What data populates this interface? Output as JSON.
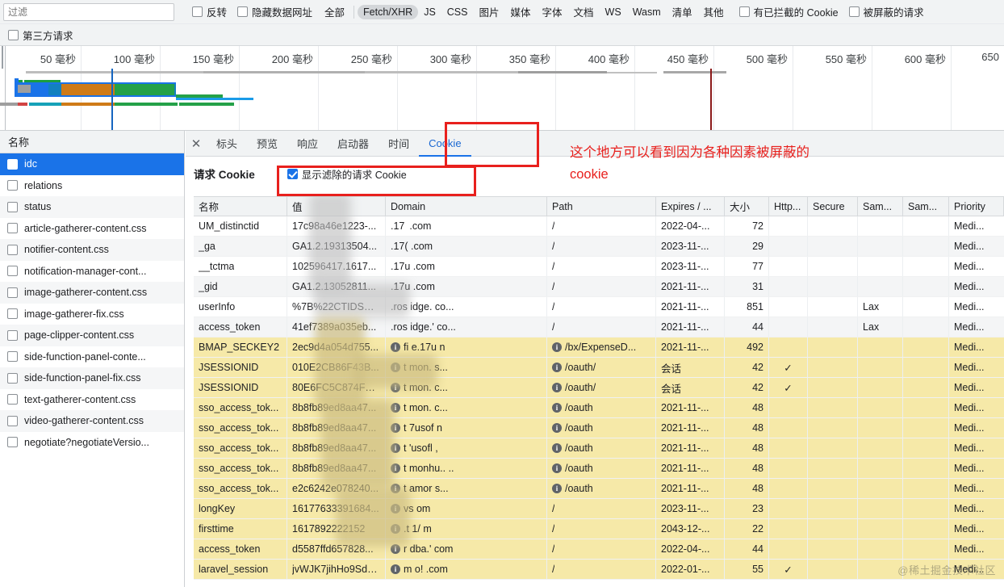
{
  "toolbar": {
    "filter_placeholder": "过滤",
    "invert_label": "反转",
    "hide_data_urls_label": "隐藏数据网址",
    "types": [
      {
        "label": "全部",
        "active": false
      },
      {
        "label": "Fetch/XHR",
        "active": true
      },
      {
        "label": "JS",
        "active": false
      },
      {
        "label": "CSS",
        "active": false
      },
      {
        "label": "图片",
        "active": false
      },
      {
        "label": "媒体",
        "active": false
      },
      {
        "label": "字体",
        "active": false
      },
      {
        "label": "文档",
        "active": false
      },
      {
        "label": "WS",
        "active": false
      },
      {
        "label": "Wasm",
        "active": false
      },
      {
        "label": "清单",
        "active": false
      },
      {
        "label": "其他",
        "active": false
      }
    ],
    "blocked_cookies_label": "有已拦截的 Cookie",
    "blocked_requests_label": "被屏蔽的请求",
    "third_party_label": "第三方请求"
  },
  "overview": {
    "ticks": [
      "50 毫秒",
      "100 毫秒",
      "150 毫秒",
      "200 毫秒",
      "250 毫秒",
      "300 毫秒",
      "350 毫秒",
      "400 毫秒",
      "450 毫秒",
      "500 毫秒",
      "550 毫秒",
      "600 毫秒",
      "650"
    ],
    "dom_content_loaded_color": "#1565c0",
    "load_event_color": "#8b1a1a"
  },
  "sidebar": {
    "header": "名称",
    "items": [
      {
        "name": "idc",
        "selected": true
      },
      {
        "name": "relations",
        "selected": false
      },
      {
        "name": "status",
        "selected": false
      },
      {
        "name": "article-gatherer-content.css",
        "selected": false
      },
      {
        "name": "notifier-content.css",
        "selected": false
      },
      {
        "name": "notification-manager-cont...",
        "selected": false
      },
      {
        "name": "image-gatherer-content.css",
        "selected": false
      },
      {
        "name": "image-gatherer-fix.css",
        "selected": false
      },
      {
        "name": "page-clipper-content.css",
        "selected": false
      },
      {
        "name": "side-function-panel-conte...",
        "selected": false
      },
      {
        "name": "side-function-panel-fix.css",
        "selected": false
      },
      {
        "name": "text-gatherer-content.css",
        "selected": false
      },
      {
        "name": "video-gatherer-content.css",
        "selected": false
      },
      {
        "name": "negotiate?negotiateVersio...",
        "selected": false
      }
    ]
  },
  "detail": {
    "close_label": "✕",
    "tabs": [
      {
        "label": "标头",
        "active": false
      },
      {
        "label": "预览",
        "active": false
      },
      {
        "label": "响应",
        "active": false
      },
      {
        "label": "启动器",
        "active": false
      },
      {
        "label": "时间",
        "active": false
      },
      {
        "label": "Cookie",
        "active": true
      }
    ],
    "section_title": "请求 Cookie",
    "show_filtered_label": "显示滤除的请求 Cookie",
    "show_filtered_checked": true
  },
  "annotation": {
    "text": "这个地方可以看到因为各种因素被屏蔽的\ncookie",
    "color": "#e8201d"
  },
  "cookie_table": {
    "columns": [
      "名称",
      "值",
      "Domain",
      "Path",
      "Expires / ...",
      "大小",
      "Http...",
      "Secure",
      "Sam...",
      "Sam...",
      "Priority"
    ],
    "rows": [
      {
        "name": "UM_distinctid",
        "value": "17c98a46e1223-...",
        "domain": ".17    .com",
        "domain_info": false,
        "path": "/",
        "path_info": false,
        "expires": "2022-04-...",
        "size": "72",
        "http": "",
        "secure": "",
        "samesite": "",
        "sameparty": "",
        "priority": "Medi...",
        "blocked": false,
        "shade": "white"
      },
      {
        "name": "_ga",
        "value": "GA1.2.19313504...",
        "domain": ".17(   .com",
        "domain_info": false,
        "path": "/",
        "path_info": false,
        "expires": "2023-11-...",
        "size": "29",
        "http": "",
        "secure": "",
        "samesite": "",
        "sameparty": "",
        "priority": "Medi...",
        "blocked": false,
        "shade": "grey"
      },
      {
        "name": "__tctma",
        "value": "102596417.1617...",
        "domain": ".17u   .com",
        "domain_info": false,
        "path": "/",
        "path_info": false,
        "expires": "2023-11-...",
        "size": "77",
        "http": "",
        "secure": "",
        "samesite": "",
        "sameparty": "",
        "priority": "Medi...",
        "blocked": false,
        "shade": "white"
      },
      {
        "name": "_gid",
        "value": "GA1.2.13052811...",
        "domain": ".17u   .com",
        "domain_info": false,
        "path": "/",
        "path_info": false,
        "expires": "2021-11-...",
        "size": "31",
        "http": "",
        "secure": "",
        "samesite": "",
        "sameparty": "",
        "priority": "Medi...",
        "blocked": false,
        "shade": "grey"
      },
      {
        "name": "userInfo",
        "value": "%7B%22CTIDS%...",
        "domain": ".ros   idge.      co...",
        "domain_info": false,
        "path": "/",
        "path_info": false,
        "expires": "2021-11-...",
        "size": "851",
        "http": "",
        "secure": "",
        "samesite": "Lax",
        "sameparty": "",
        "priority": "Medi...",
        "blocked": false,
        "shade": "white"
      },
      {
        "name": "access_token",
        "value": "41ef7389a035eb...",
        "domain": ".ros   idge.'     co...",
        "domain_info": false,
        "path": "/",
        "path_info": false,
        "expires": "2021-11-...",
        "size": "44",
        "http": "",
        "secure": "",
        "samesite": "Lax",
        "sameparty": "",
        "priority": "Medi...",
        "blocked": false,
        "shade": "grey"
      },
      {
        "name": "BMAP_SECKEY2",
        "value": "2ec9d4a054d755...",
        "domain": "fi   e.17u      n",
        "domain_info": true,
        "path": "/bx/ExpenseD...",
        "path_info": true,
        "expires": "2021-11-...",
        "size": "492",
        "http": "",
        "secure": "",
        "samesite": "",
        "sameparty": "",
        "priority": "Medi...",
        "blocked": true,
        "shade": "yellow"
      },
      {
        "name": "JSESSIONID",
        "value": "010E2CB86F43B...",
        "domain": "t   mon.      s...",
        "domain_info": true,
        "path": "/oauth/",
        "path_info": true,
        "expires": "会话",
        "size": "42",
        "http": "✓",
        "secure": "",
        "samesite": "",
        "sameparty": "",
        "priority": "Medi...",
        "blocked": true,
        "shade": "yellow"
      },
      {
        "name": "JSESSIONID",
        "value": "80E6FC5C874F6E...",
        "domain": "t   mon.      c...",
        "domain_info": true,
        "path": "/oauth/",
        "path_info": true,
        "expires": "会话",
        "size": "42",
        "http": "✓",
        "secure": "",
        "samesite": "",
        "sameparty": "",
        "priority": "Medi...",
        "blocked": true,
        "shade": "yellow"
      },
      {
        "name": "sso_access_tok...",
        "value": "8b8fb89ed8aa47...",
        "domain": "t   mon.      c...",
        "domain_info": true,
        "path": "/oauth",
        "path_info": true,
        "expires": "2021-11-...",
        "size": "48",
        "http": "",
        "secure": "",
        "samesite": "",
        "sameparty": "",
        "priority": "Medi...",
        "blocked": true,
        "shade": "yellow"
      },
      {
        "name": "sso_access_tok...",
        "value": "8b8fb89ed8aa47...",
        "domain": "t   7usof    n",
        "domain_info": true,
        "path": "/oauth",
        "path_info": true,
        "expires": "2021-11-...",
        "size": "48",
        "http": "",
        "secure": "",
        "samesite": "",
        "sameparty": "",
        "priority": "Medi...",
        "blocked": true,
        "shade": "yellow"
      },
      {
        "name": "sso_access_tok...",
        "value": "8b8fb89ed8aa47...",
        "domain": "t   'usofl    ,",
        "domain_info": true,
        "path": "/oauth",
        "path_info": true,
        "expires": "2021-11-...",
        "size": "48",
        "http": "",
        "secure": "",
        "samesite": "",
        "sameparty": "",
        "priority": "Medi...",
        "blocked": true,
        "shade": "yellow"
      },
      {
        "name": "sso_access_tok...",
        "value": "8b8fb89ed8aa47...",
        "domain": "t   monhu..    ..",
        "domain_info": true,
        "path": "/oauth",
        "path_info": true,
        "expires": "2021-11-...",
        "size": "48",
        "http": "",
        "secure": "",
        "samesite": "",
        "sameparty": "",
        "priority": "Medi...",
        "blocked": true,
        "shade": "yellow"
      },
      {
        "name": "sso_access_tok...",
        "value": "e2c6242e078240...",
        "domain": "t   amor      s...",
        "domain_info": true,
        "path": "/oauth",
        "path_info": true,
        "expires": "2021-11-...",
        "size": "48",
        "http": "",
        "secure": "",
        "samesite": "",
        "sameparty": "",
        "priority": "Medi...",
        "blocked": true,
        "shade": "yellow"
      },
      {
        "name": "longKey",
        "value": "16177633391684...",
        "domain": "vs          om",
        "domain_info": true,
        "path": "/",
        "path_info": false,
        "expires": "2023-11-...",
        "size": "23",
        "http": "",
        "secure": "",
        "samesite": "",
        "sameparty": "",
        "priority": "Medi...",
        "blocked": true,
        "shade": "yellow"
      },
      {
        "name": "firsttime",
        "value": "1617892222152",
        "domain": ".t    1/     m",
        "domain_info": true,
        "path": "/",
        "path_info": false,
        "expires": "2043-12-...",
        "size": "22",
        "http": "",
        "secure": "",
        "samesite": "",
        "sameparty": "",
        "priority": "Medi...",
        "blocked": true,
        "shade": "yellow"
      },
      {
        "name": "access_token",
        "value": "d5587ffd657828...",
        "domain": "r    dba.'      com",
        "domain_info": true,
        "path": "/",
        "path_info": false,
        "expires": "2022-04-...",
        "size": "44",
        "http": "",
        "secure": "",
        "samesite": "",
        "sameparty": "",
        "priority": "Medi...",
        "blocked": true,
        "shade": "yellow"
      },
      {
        "name": "laravel_session",
        "value": "jvWJK7jihHo9Sdz...",
        "domain": "m    o!      .com",
        "domain_info": true,
        "path": "/",
        "path_info": false,
        "expires": "2022-01-...",
        "size": "55",
        "http": "✓",
        "secure": "",
        "samesite": "",
        "sameparty": "",
        "priority": "Medi...",
        "blocked": true,
        "shade": "yellow"
      }
    ]
  },
  "watermark": "@稀土掘金技术社区"
}
